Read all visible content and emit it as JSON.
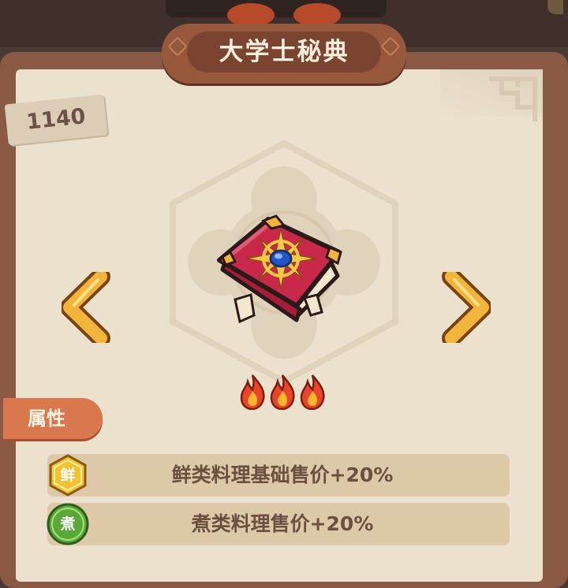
{
  "title": "大学士秘典",
  "item_number": "1140",
  "item_name_icon": "red-book-icon",
  "navigation": {
    "prev_icon": "chevron-left-icon",
    "next_icon": "chevron-right-icon"
  },
  "rarity": {
    "level": 3,
    "icon": "flame-icon"
  },
  "attributes": {
    "tab_label": "属性",
    "items": [
      {
        "badge": "鲜",
        "badge_color": "#f2c233",
        "text": "鲜类料理基础售价+20%"
      },
      {
        "badge": "煮",
        "badge_color": "#5aa83a",
        "text": "煮类料理售价+20%"
      }
    ]
  },
  "colors": {
    "panel": "#ece1cd",
    "frame": "#8a5a45",
    "title_plate": "#97583c",
    "accent_orange": "#d9774f",
    "arrow_gold": "#f0b53a"
  }
}
